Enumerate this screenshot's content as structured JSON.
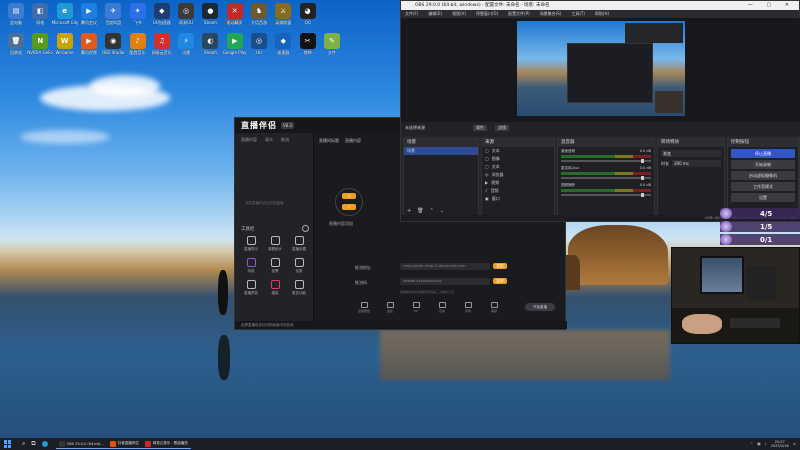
{
  "desktop": {
    "icons": [
      {
        "label": "此电脑",
        "glyph": "▤",
        "color": "#3b7bd4"
      },
      {
        "label": "网络",
        "glyph": "◧",
        "color": "#3c6db0"
      },
      {
        "label": "Microsoft Edge",
        "glyph": "e",
        "color": "#1f9ad6"
      },
      {
        "label": "腾讯会议",
        "glyph": "▶",
        "color": "#1f7fe0"
      },
      {
        "label": "百度网盘",
        "glyph": "✈",
        "color": "#3a7bd5"
      },
      {
        "label": "飞书",
        "glyph": "✦",
        "color": "#2d6fe8"
      },
      {
        "label": "UU加速器",
        "glyph": "◆",
        "color": "#1e3c72"
      },
      {
        "label": "网易UU",
        "glyph": "◎",
        "color": "#3a3a3a"
      },
      {
        "label": "Steam",
        "glyph": "●",
        "color": "#1b2838"
      },
      {
        "label": "驱动精灵",
        "glyph": "✕",
        "color": "#c62828"
      },
      {
        "label": "大话西游",
        "glyph": "♞",
        "color": "#6d5b2e"
      },
      {
        "label": "英雄联盟",
        "glyph": "⚔",
        "color": "#8a6a20"
      },
      {
        "label": "QQ",
        "glyph": "◕",
        "color": "#222"
      },
      {
        "label": "回收站",
        "glyph": "🗑",
        "color": "#4a6f9a"
      },
      {
        "label": "NVIDIA GeForce",
        "glyph": "N",
        "color": "#5a9a1a"
      },
      {
        "label": "WeGame",
        "glyph": "W",
        "color": "#c9a400"
      },
      {
        "label": "腾讯视频",
        "glyph": "▶",
        "color": "#e05a1e"
      },
      {
        "label": "OBS Studio",
        "glyph": "◉",
        "color": "#333"
      },
      {
        "label": "酷我音乐",
        "glyph": "♪",
        "color": "#e08010"
      },
      {
        "label": "网易云音乐",
        "glyph": "♫",
        "color": "#d32f2f"
      },
      {
        "label": "迅雷",
        "glyph": "⚡",
        "color": "#1e88e5"
      },
      {
        "label": "Steam",
        "glyph": "◐",
        "color": "#2a475e"
      },
      {
        "label": "Google Play",
        "glyph": "▶",
        "color": "#1fa855"
      },
      {
        "label": "UU",
        "glyph": "◎",
        "color": "#1a4d8c"
      },
      {
        "label": "加速器",
        "glyph": "◆",
        "color": "#1565c0"
      },
      {
        "label": "剪映",
        "glyph": "✂",
        "color": "#111"
      },
      {
        "label": "文件",
        "glyph": "✎",
        "color": "#7cb342"
      }
    ]
  },
  "zhibo": {
    "logo": "直播伴侣",
    "version": "V8.3",
    "left_tabs": [
      "直播内容",
      "观众",
      "推流"
    ],
    "hint": "添加直播内容后开始直播",
    "tools_title": "工具栏",
    "tools": [
      "直播提示",
      "观看统计",
      "直播设置",
      "特效",
      "投票",
      "连麦",
      "直播预告",
      "福袋",
      "更多功能"
    ],
    "top_tabs": [
      "直播间标题",
      "直播内容"
    ],
    "area_label": "直播内容添加",
    "stream_url_label": "推流地址",
    "stream_url_value": "rtmp://push-rtmp-l1.douyincdn.com",
    "stream_key_label": "推流码",
    "stream_key_value": "stream-xxxxxxxxxxxx",
    "copy": "复制",
    "note": "复制推流地址和推流码到第三方推流工具",
    "bottom_tools": [
      "直播预告",
      "连麦",
      "PK",
      "互动",
      "音效",
      "美颜"
    ],
    "end_button": "开始直播",
    "status": "全屏直播将自动识别画面中的游戏"
  },
  "obs": {
    "title": "OBS 29.0.0 (64-bit, windows) - 配置文件: 未命名 - 场景: 未命名",
    "window_controls": "— ▢ ✕",
    "menu": [
      "文件(F)",
      "编辑(E)",
      "视图(V)",
      "停靠窗口(D)",
      "配置文件(P)",
      "场景集合(S)",
      "工具(T)",
      "帮助(H)"
    ],
    "dock_labels": [
      "未选择来源",
      "属性",
      "滤镜"
    ],
    "scenes_header": "场景",
    "scenes": [
      "场景"
    ],
    "sources_header": "来源",
    "sources": [
      "文本",
      "图像",
      "文本",
      "浏览器",
      "视频",
      "音频",
      "窗口"
    ],
    "mixer_header": "混音器",
    "mixer": [
      {
        "name": "桌面音频",
        "db": "0.0 dB"
      },
      {
        "name": "麦克风/Aux",
        "db": "0.0 dB"
      },
      {
        "name": "视频捕获",
        "db": "0.0 dB"
      }
    ],
    "transitions_header": "转场特效",
    "transition_value": "渐变",
    "duration_label": "时长",
    "duration_value": "300 ms",
    "controls_header": "控制按钮",
    "controls": [
      "停止直播",
      "开始录制",
      "启动虚拟摄像机",
      "工作室模式",
      "设置",
      "退出"
    ],
    "status": "LIVE: 00:00:00  REC: 00:00:00  CPU: 1.5%, 60.00 fps"
  },
  "overlay": {
    "ranks": [
      "4/5",
      "1/5",
      "0/1"
    ]
  },
  "taskbar": {
    "items": [
      {
        "label": "OBS 29.0.0 (64-bit)...",
        "color": "#333"
      },
      {
        "label": "抖音直播伴侣",
        "color": "#e65100"
      },
      {
        "label": "网易云音乐 - 歌曲播放",
        "color": "#c62828"
      }
    ],
    "time": "20:27",
    "date": "2023/2/16"
  }
}
